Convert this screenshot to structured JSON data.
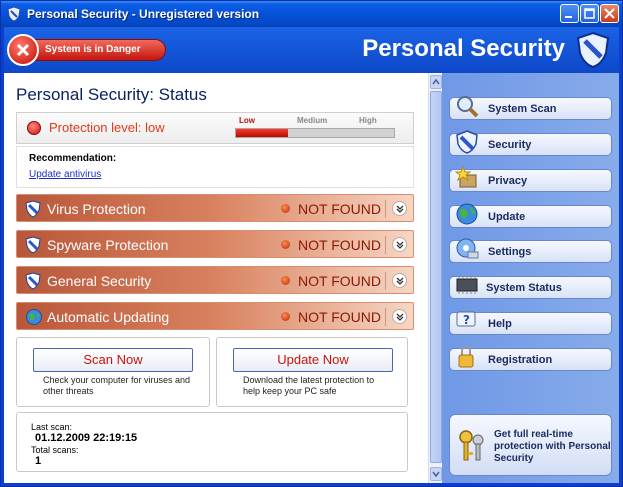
{
  "window": {
    "title": "Personal Security - Unregistered version"
  },
  "header": {
    "danger_text": "System is in Danger",
    "brand": "Personal Security"
  },
  "status": {
    "title": "Personal Security: Status",
    "protection_label": "Protection level: low",
    "levels": [
      "Low",
      "Medium",
      "High"
    ],
    "level_value": 0.33,
    "recommendation_label": "Recommendation:",
    "recommendation_link": "Update antivirus"
  },
  "rows": [
    {
      "label": "Virus Protection",
      "status": "NOT FOUND"
    },
    {
      "label": "Spyware Protection",
      "status": "NOT FOUND"
    },
    {
      "label": "General Security",
      "status": "NOT FOUND"
    },
    {
      "label": "Automatic Updating",
      "status": "NOT FOUND"
    }
  ],
  "actions": {
    "scan_label": "Scan Now",
    "scan_desc": "Check your computer for viruses and other threats",
    "update_label": "Update Now",
    "update_desc": "Download the latest protection to help keep your PC safe"
  },
  "scan_info": {
    "last_scan_label": "Last scan:",
    "last_scan_value": "01.12.2009 22:19:15",
    "total_label": "Total scans:",
    "total_value": "1"
  },
  "sidebar": {
    "items": [
      {
        "label": "System Scan",
        "icon": "magnifier-icon"
      },
      {
        "label": "Security",
        "icon": "shield-icon"
      },
      {
        "label": "Privacy",
        "icon": "privacy-star-icon"
      },
      {
        "label": "Update",
        "icon": "globe-icon"
      },
      {
        "label": "Settings",
        "icon": "settings-icon"
      },
      {
        "label": "System Status",
        "icon": "chip-icon"
      },
      {
        "label": "Help",
        "icon": "help-icon"
      },
      {
        "label": "Registration",
        "icon": "lock-icon"
      }
    ],
    "promo_text": "Get full real-time protection with Personal Security",
    "promo_icon": "keys-icon"
  },
  "colors": {
    "accent": "#0a3fd1",
    "danger": "#c4150e",
    "row": "#d9825f"
  }
}
